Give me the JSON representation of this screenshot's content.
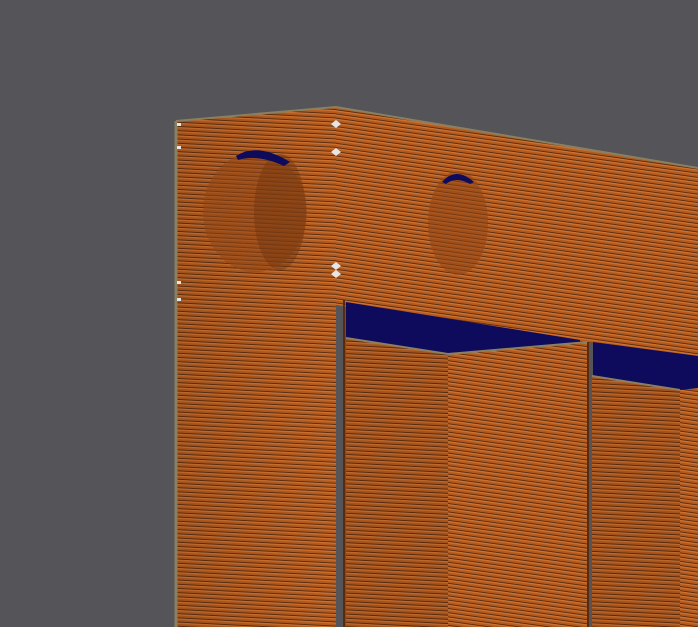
{
  "viewport": {
    "background_color": "#545459",
    "view": "3d-layer-preview"
  },
  "model": {
    "perimeter_color": "#b25a1e",
    "perimeter_highlight_color": "#cd7232",
    "layer_gap_color": "#5a2a0c",
    "top_infill_color": "#0e0b5c",
    "edge_color": "#8a8060",
    "seam_marker_color": "#e6e6e6",
    "features": [
      "left-wall",
      "upper-back-wall",
      "two-round-holes",
      "two-top-infill-pockets",
      "seam-markers"
    ]
  }
}
